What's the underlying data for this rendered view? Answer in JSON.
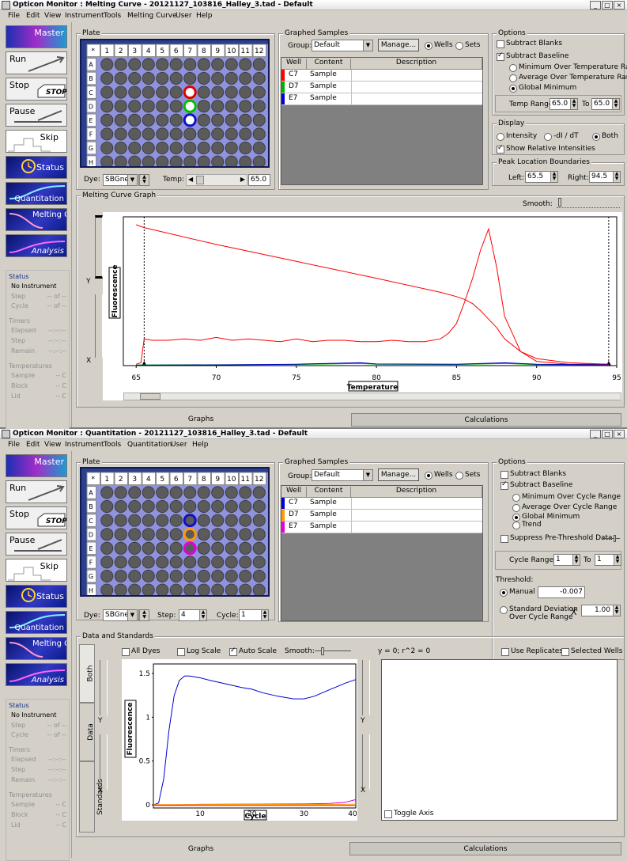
{
  "menu_items": [
    "File",
    "Edit",
    "View",
    "Instrument",
    "Tools",
    "Melting Curve",
    "User",
    "Help"
  ],
  "win1": {
    "title": "Opticon Monitor : Melting Curve - 20121127_103816_Halley_3.tad - Default",
    "menu": [
      "File",
      "Edit",
      "View",
      "Instrument",
      "Tools",
      "Melting Curve",
      "User",
      "Help"
    ],
    "plate_label": "Plate",
    "dye_label": "Dye:",
    "dye_value": "SBGne•",
    "temp_label": "Temp:",
    "temp_value": "65.0",
    "graphed_label": "Graphed Samples",
    "group_label": "Group:",
    "group_value": "Default",
    "manage": "Manage...",
    "wells": "Wells",
    "sets": "Sets",
    "table_headers": [
      "Well",
      "Content",
      "Description"
    ],
    "rows": [
      {
        "well": "C7",
        "content": "Sample",
        "color": "#ff0000"
      },
      {
        "well": "D7",
        "content": "Sample",
        "color": "#00b000"
      },
      {
        "well": "E7",
        "content": "Sample",
        "color": "#0000d0"
      }
    ],
    "options_label": "Options",
    "subtract_blanks": "Subtract Blanks",
    "subtract_baseline": "Subtract Baseline",
    "opt1": "Minimum Over Temperature Range",
    "opt2": "Average Over Temperature Range",
    "opt3": "Global Minimum",
    "temp_range_label": "Temp Range:",
    "temp_range_from": "65.0",
    "to_label": "To",
    "temp_range_to": "65.0",
    "display_label": "Display",
    "intensity": "Intensity",
    "dldt": "-dI / dT",
    "both": "Both",
    "show_rel": "Show Relative Intensities",
    "peak_label": "Peak Location Boundaries",
    "left_label": "Left:",
    "left_value": "65.5",
    "right_label": "Right:",
    "right_value": "94.5",
    "graph_label": "Melting Curve Graph",
    "smooth_label": "Smooth:",
    "y_label": "Y",
    "x_label": "X",
    "tab_graphs": "Graphs",
    "tab_calc": "Calculations",
    "chart_data": {
      "type": "line",
      "xlabel": "Temperature",
      "ylabel": "Fluorescence",
      "xlim": [
        64.2,
        95
      ],
      "ticks": [
        65,
        70,
        75,
        80,
        85,
        90,
        95
      ],
      "series": [
        {
          "color": "#ff0000",
          "x": [
            65,
            65.5,
            70,
            75,
            80,
            84,
            85,
            85.5,
            86,
            86.5,
            87,
            87.5,
            88,
            89,
            90,
            92,
            94.5
          ],
          "y": [
            1.0,
            0.98,
            0.86,
            0.74,
            0.62,
            0.52,
            0.49,
            0.47,
            0.44,
            0.39,
            0.33,
            0.27,
            0.19,
            0.1,
            0.05,
            0.02,
            0.01
          ]
        },
        {
          "color": "#ff0000",
          "x": [
            65,
            65.3,
            65.5,
            66,
            67,
            68,
            69,
            70,
            71,
            72,
            73,
            74,
            75,
            76,
            77,
            78,
            79,
            80,
            81,
            82,
            83,
            84,
            84.5,
            85,
            85.5,
            86,
            86.5,
            87,
            87.5,
            88,
            89,
            90,
            92,
            94.5
          ],
          "y": [
            0.01,
            0.02,
            0.19,
            0.18,
            0.18,
            0.19,
            0.18,
            0.2,
            0.18,
            0.19,
            0.18,
            0.17,
            0.19,
            0.17,
            0.18,
            0.18,
            0.17,
            0.17,
            0.18,
            0.17,
            0.17,
            0.19,
            0.23,
            0.3,
            0.45,
            0.62,
            0.82,
            0.97,
            0.7,
            0.35,
            0.1,
            0.03,
            0.01,
            0.01
          ]
        },
        {
          "color": "#00b000",
          "x": [
            65,
            70,
            75,
            79,
            80,
            85,
            88,
            90,
            94.5
          ],
          "y": [
            0.005,
            0.006,
            0.008,
            0.015,
            0.01,
            0.008,
            0.015,
            0.007,
            0.005
          ]
        },
        {
          "color": "#0000d0",
          "x": [
            65,
            70,
            75,
            79,
            80,
            85,
            88,
            90,
            94.5
          ],
          "y": [
            0.003,
            0.005,
            0.01,
            0.02,
            0.012,
            0.01,
            0.02,
            0.01,
            0.006
          ]
        }
      ]
    }
  },
  "win2": {
    "title": "Opticon Monitor : Quantitation - 20121127_103816_Halley_3.tad - Default",
    "menu": [
      "File",
      "Edit",
      "View",
      "Instrument",
      "Tools",
      "Quantitation",
      "User",
      "Help"
    ],
    "plate_label": "Plate",
    "dye_label": "Dye:",
    "dye_value": "SBGne",
    "step_label": "Step:",
    "step_value": "4",
    "cycle_label": "Cycle:",
    "cycle_value": "1",
    "graphed_label": "Graphed Samples",
    "group_label": "Group:",
    "group_value": "Default",
    "manage": "Manage...",
    "wells": "Wells",
    "sets": "Sets",
    "table_headers": [
      "Well",
      "Content",
      "Description"
    ],
    "rows": [
      {
        "well": "C7",
        "content": "Sample",
        "color": "#0000d0"
      },
      {
        "well": "D7",
        "content": "Sample",
        "color": "#ff9900"
      },
      {
        "well": "E7",
        "content": "Sample",
        "color": "#e000e0"
      }
    ],
    "options_label": "Options",
    "subtract_blanks": "Subtract Blanks",
    "subtract_baseline": "Subtract Baseline",
    "opt1": "Minimum Over Cycle Range",
    "opt2": "Average Over Cycle Range",
    "opt3": "Global Minimum",
    "opt4": "Trend",
    "suppress": "Suppress Pre-Threshold Data",
    "cycle_range_label": "Cycle Range:",
    "cycle_from": "1",
    "to_label": "To",
    "cycle_to": "1",
    "threshold_label": "Threshold:",
    "manual": "Manual",
    "manual_value": "-0.007",
    "stddev": "Standard Deviation",
    "stddev2": "Over Cycle Range",
    "x_label": "X",
    "stddev_value": "1.00",
    "data_label": "Data and Standards",
    "all_dyes": "All Dyes",
    "log_scale": "Log Scale",
    "auto_scale": "Auto Scale",
    "smooth_label": "Smooth:",
    "fit_text": "y = 0;  r^2 = 0",
    "use_replicates": "Use Replicates",
    "selected_wells": "Selected Wells",
    "vtab_both": "Both",
    "vtab_data": "Data",
    "vtab_standards": "Standards",
    "y_label": "Y",
    "toggle_axis": "Toggle Axis",
    "tab_graphs": "Graphs",
    "tab_calc": "Calculations",
    "chart_data": {
      "type": "line",
      "xlabel": "Cycle",
      "ylabel": "Fluorescence",
      "xlim": [
        1,
        40
      ],
      "ylim": [
        0,
        1.5
      ],
      "xticks": [
        10,
        20,
        30,
        40
      ],
      "yticks": [
        0,
        0.5,
        1,
        1.5
      ],
      "series": [
        {
          "color": "#0000d0",
          "x": [
            1,
            2,
            3,
            4,
            5,
            6,
            7,
            8,
            10,
            12,
            15,
            18,
            20,
            22,
            25,
            28,
            30,
            32,
            34,
            36,
            38,
            40
          ],
          "y": [
            0,
            0.02,
            0.3,
            0.85,
            1.25,
            1.42,
            1.47,
            1.47,
            1.45,
            1.42,
            1.38,
            1.34,
            1.32,
            1.28,
            1.24,
            1.21,
            1.21,
            1.24,
            1.29,
            1.34,
            1.39,
            1.43
          ]
        },
        {
          "color": "#e000e0",
          "x": [
            1,
            5,
            10,
            20,
            30,
            35,
            38,
            40
          ],
          "y": [
            0,
            0,
            0.005,
            0.008,
            0.01,
            0.015,
            0.03,
            0.06
          ]
        },
        {
          "color": "#ff9900",
          "x": [
            1,
            10,
            20,
            30,
            40
          ],
          "y": [
            0.003,
            0.004,
            0.005,
            0.004,
            0.006
          ]
        }
      ]
    }
  },
  "sidebar": {
    "buttons": [
      "Master",
      "Run",
      "Stop",
      "Pause",
      "Skip",
      "Status",
      "Quantitation",
      "Melting Curve",
      "Analysis"
    ],
    "status_title": "Status",
    "no_instrument": "No Instrument",
    "step": "Step",
    "cycle": "Cycle",
    "of": "-- of --",
    "timers": "Timers",
    "elapsed": "Elapsed",
    "t_step": "Step",
    "remain": "Remain",
    "dashes": "--:--:--",
    "temperatures": "Temperatures",
    "sample": "Sample",
    "block": "Block",
    "lid": "Lid",
    "tC": "-- C"
  }
}
